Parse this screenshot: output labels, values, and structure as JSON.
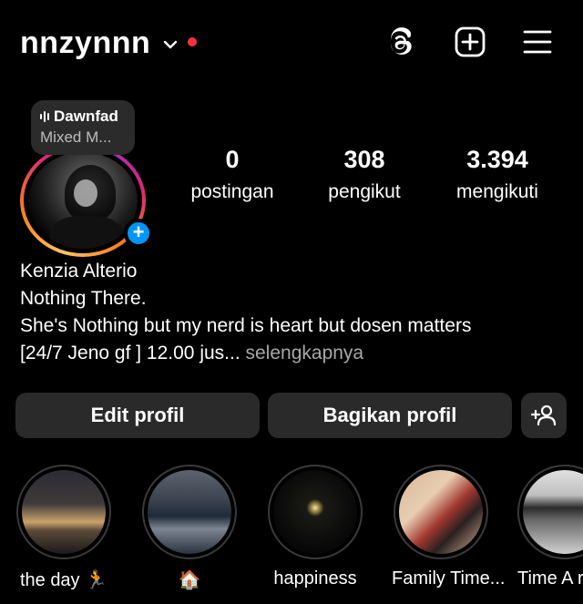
{
  "header": {
    "username": "nnzynnn",
    "icons": [
      "chevron-down-icon",
      "notification-dot",
      "threads-icon",
      "create-icon",
      "menu-icon"
    ]
  },
  "note": {
    "title": "Dawnfad",
    "subtitle": "Mixed M..."
  },
  "stats": [
    {
      "value": "0",
      "label": "postingan"
    },
    {
      "value": "308",
      "label": "pengikut"
    },
    {
      "value": "3.394",
      "label": "mengikuti"
    }
  ],
  "bio": {
    "name": "Kenzia Alterio",
    "line1": "Nothing There.",
    "line2": "She's Nothing but my nerd is heart but dosen matters",
    "line3": "[24/7 Jeno gf ] 12.00 jus...",
    "more": " selengkapnya"
  },
  "buttons": {
    "edit": "Edit profil",
    "share": "Bagikan profil"
  },
  "highlights": [
    {
      "label": "the day 🏃"
    },
    {
      "label": "🏠"
    },
    {
      "label": "happiness"
    },
    {
      "label": "Family Time..."
    },
    {
      "label": "Time A ra"
    }
  ],
  "colors": {
    "background": "#000000",
    "accent": "#0095f6",
    "notification": "#ff3040",
    "button": "#2a2a2a"
  }
}
